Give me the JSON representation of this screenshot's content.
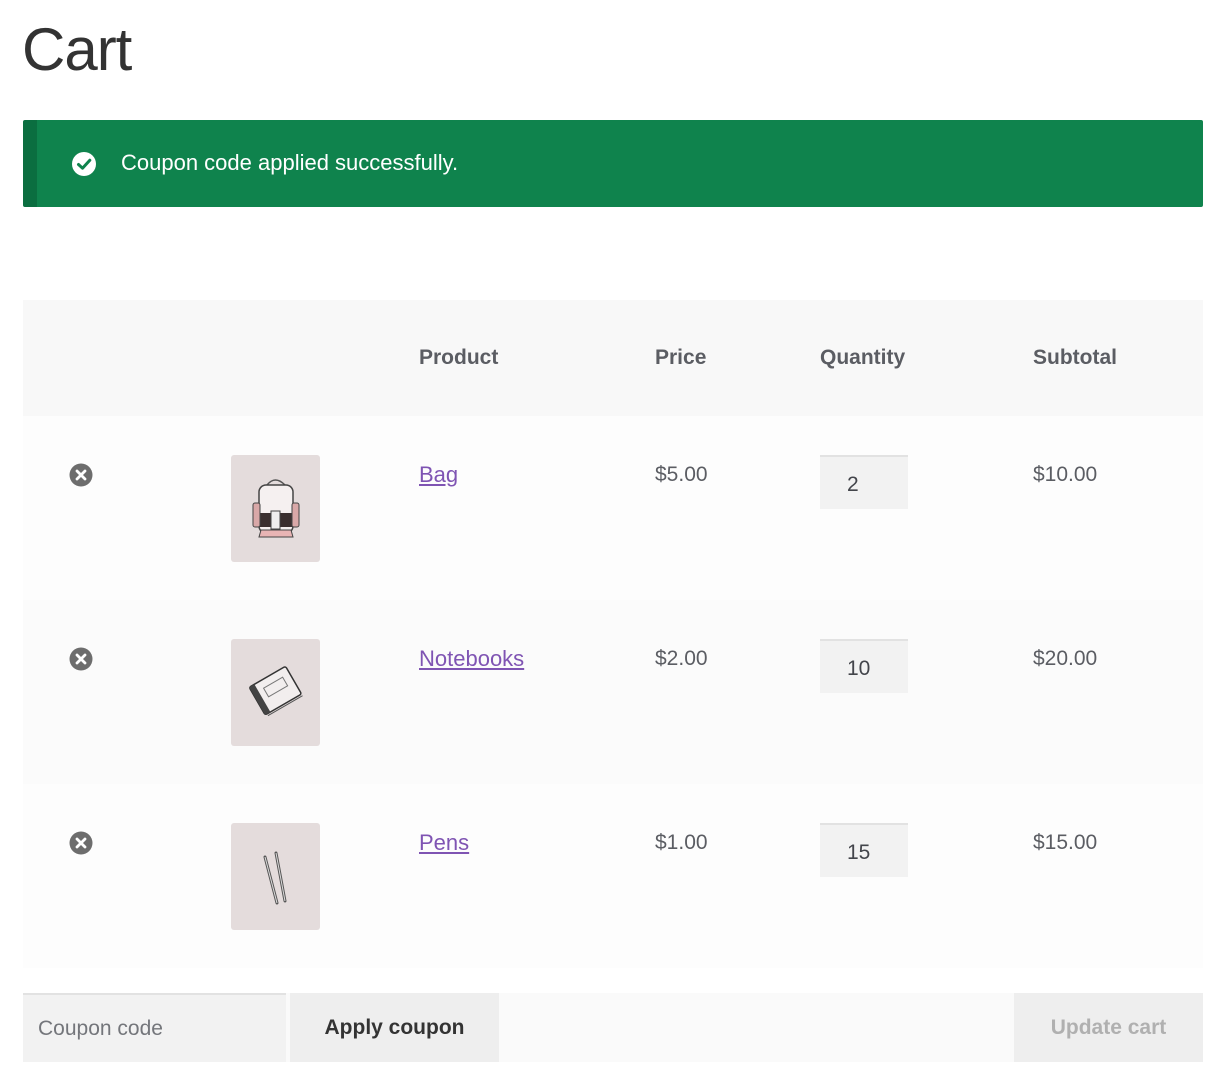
{
  "page": {
    "title": "Cart"
  },
  "notice": {
    "message": "Coupon code applied successfully.",
    "icon": "check-circle-icon",
    "background_color": "#0f834d"
  },
  "table": {
    "headers": {
      "product": "Product",
      "price": "Price",
      "quantity": "Quantity",
      "subtotal": "Subtotal"
    },
    "rows": [
      {
        "name": "Bag",
        "price": "$5.00",
        "quantity": "2",
        "subtotal": "$10.00",
        "thumbnail_icon": "backpack-image"
      },
      {
        "name": "Notebooks",
        "price": "$2.00",
        "quantity": "10",
        "subtotal": "$20.00",
        "thumbnail_icon": "notebook-image"
      },
      {
        "name": "Pens",
        "price": "$1.00",
        "quantity": "15",
        "subtotal": "$15.00",
        "thumbnail_icon": "pens-image"
      }
    ]
  },
  "actions": {
    "coupon_placeholder": "Coupon code",
    "apply_label": "Apply coupon",
    "update_label": "Update cart"
  },
  "colors": {
    "link": "#7f54b3",
    "remove_icon": "#6d6d6d"
  }
}
